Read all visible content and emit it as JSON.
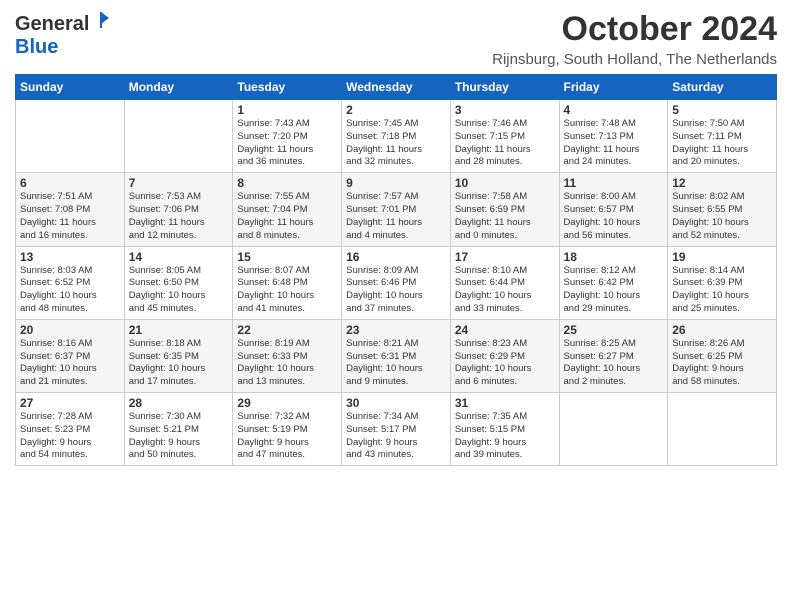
{
  "logo": {
    "general": "General",
    "blue": "Blue"
  },
  "title": "October 2024",
  "location": "Rijnsburg, South Holland, The Netherlands",
  "days_of_week": [
    "Sunday",
    "Monday",
    "Tuesday",
    "Wednesday",
    "Thursday",
    "Friday",
    "Saturday"
  ],
  "weeks": [
    [
      {
        "day": "",
        "info": ""
      },
      {
        "day": "",
        "info": ""
      },
      {
        "day": "1",
        "info": "Sunrise: 7:43 AM\nSunset: 7:20 PM\nDaylight: 11 hours\nand 36 minutes."
      },
      {
        "day": "2",
        "info": "Sunrise: 7:45 AM\nSunset: 7:18 PM\nDaylight: 11 hours\nand 32 minutes."
      },
      {
        "day": "3",
        "info": "Sunrise: 7:46 AM\nSunset: 7:15 PM\nDaylight: 11 hours\nand 28 minutes."
      },
      {
        "day": "4",
        "info": "Sunrise: 7:48 AM\nSunset: 7:13 PM\nDaylight: 11 hours\nand 24 minutes."
      },
      {
        "day": "5",
        "info": "Sunrise: 7:50 AM\nSunset: 7:11 PM\nDaylight: 11 hours\nand 20 minutes."
      }
    ],
    [
      {
        "day": "6",
        "info": "Sunrise: 7:51 AM\nSunset: 7:08 PM\nDaylight: 11 hours\nand 16 minutes."
      },
      {
        "day": "7",
        "info": "Sunrise: 7:53 AM\nSunset: 7:06 PM\nDaylight: 11 hours\nand 12 minutes."
      },
      {
        "day": "8",
        "info": "Sunrise: 7:55 AM\nSunset: 7:04 PM\nDaylight: 11 hours\nand 8 minutes."
      },
      {
        "day": "9",
        "info": "Sunrise: 7:57 AM\nSunset: 7:01 PM\nDaylight: 11 hours\nand 4 minutes."
      },
      {
        "day": "10",
        "info": "Sunrise: 7:58 AM\nSunset: 6:59 PM\nDaylight: 11 hours\nand 0 minutes."
      },
      {
        "day": "11",
        "info": "Sunrise: 8:00 AM\nSunset: 6:57 PM\nDaylight: 10 hours\nand 56 minutes."
      },
      {
        "day": "12",
        "info": "Sunrise: 8:02 AM\nSunset: 6:55 PM\nDaylight: 10 hours\nand 52 minutes."
      }
    ],
    [
      {
        "day": "13",
        "info": "Sunrise: 8:03 AM\nSunset: 6:52 PM\nDaylight: 10 hours\nand 48 minutes."
      },
      {
        "day": "14",
        "info": "Sunrise: 8:05 AM\nSunset: 6:50 PM\nDaylight: 10 hours\nand 45 minutes."
      },
      {
        "day": "15",
        "info": "Sunrise: 8:07 AM\nSunset: 6:48 PM\nDaylight: 10 hours\nand 41 minutes."
      },
      {
        "day": "16",
        "info": "Sunrise: 8:09 AM\nSunset: 6:46 PM\nDaylight: 10 hours\nand 37 minutes."
      },
      {
        "day": "17",
        "info": "Sunrise: 8:10 AM\nSunset: 6:44 PM\nDaylight: 10 hours\nand 33 minutes."
      },
      {
        "day": "18",
        "info": "Sunrise: 8:12 AM\nSunset: 6:42 PM\nDaylight: 10 hours\nand 29 minutes."
      },
      {
        "day": "19",
        "info": "Sunrise: 8:14 AM\nSunset: 6:39 PM\nDaylight: 10 hours\nand 25 minutes."
      }
    ],
    [
      {
        "day": "20",
        "info": "Sunrise: 8:16 AM\nSunset: 6:37 PM\nDaylight: 10 hours\nand 21 minutes."
      },
      {
        "day": "21",
        "info": "Sunrise: 8:18 AM\nSunset: 6:35 PM\nDaylight: 10 hours\nand 17 minutes."
      },
      {
        "day": "22",
        "info": "Sunrise: 8:19 AM\nSunset: 6:33 PM\nDaylight: 10 hours\nand 13 minutes."
      },
      {
        "day": "23",
        "info": "Sunrise: 8:21 AM\nSunset: 6:31 PM\nDaylight: 10 hours\nand 9 minutes."
      },
      {
        "day": "24",
        "info": "Sunrise: 8:23 AM\nSunset: 6:29 PM\nDaylight: 10 hours\nand 6 minutes."
      },
      {
        "day": "25",
        "info": "Sunrise: 8:25 AM\nSunset: 6:27 PM\nDaylight: 10 hours\nand 2 minutes."
      },
      {
        "day": "26",
        "info": "Sunrise: 8:26 AM\nSunset: 6:25 PM\nDaylight: 9 hours\nand 58 minutes."
      }
    ],
    [
      {
        "day": "27",
        "info": "Sunrise: 7:28 AM\nSunset: 5:23 PM\nDaylight: 9 hours\nand 54 minutes."
      },
      {
        "day": "28",
        "info": "Sunrise: 7:30 AM\nSunset: 5:21 PM\nDaylight: 9 hours\nand 50 minutes."
      },
      {
        "day": "29",
        "info": "Sunrise: 7:32 AM\nSunset: 5:19 PM\nDaylight: 9 hours\nand 47 minutes."
      },
      {
        "day": "30",
        "info": "Sunrise: 7:34 AM\nSunset: 5:17 PM\nDaylight: 9 hours\nand 43 minutes."
      },
      {
        "day": "31",
        "info": "Sunrise: 7:35 AM\nSunset: 5:15 PM\nDaylight: 9 hours\nand 39 minutes."
      },
      {
        "day": "",
        "info": ""
      },
      {
        "day": "",
        "info": ""
      }
    ]
  ]
}
